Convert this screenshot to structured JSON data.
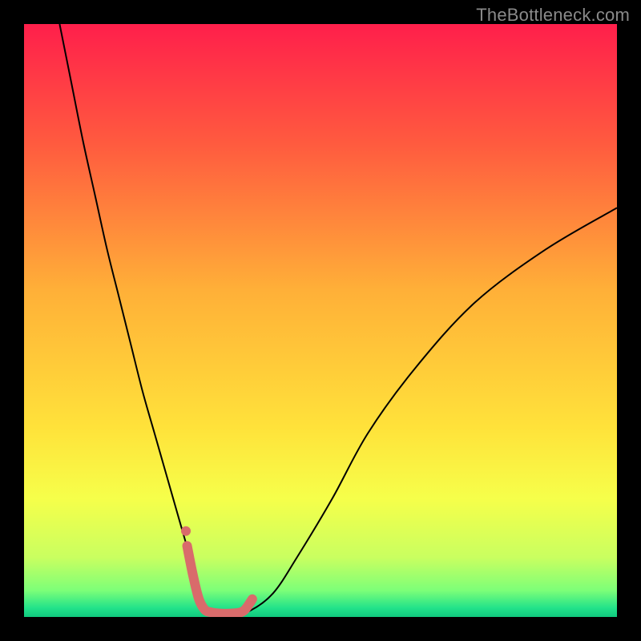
{
  "watermark": "TheBottleneck.com",
  "chart_data": {
    "type": "line",
    "title": "",
    "xlabel": "",
    "ylabel": "",
    "xlim": [
      0,
      100
    ],
    "ylim": [
      0,
      100
    ],
    "background_gradient": {
      "direction": "vertical",
      "stops": [
        {
          "pos": 0.0,
          "color": "#ff1f4b"
        },
        {
          "pos": 0.2,
          "color": "#ff5a3f"
        },
        {
          "pos": 0.45,
          "color": "#ffb038"
        },
        {
          "pos": 0.68,
          "color": "#ffe23a"
        },
        {
          "pos": 0.8,
          "color": "#f6ff4a"
        },
        {
          "pos": 0.9,
          "color": "#c9ff60"
        },
        {
          "pos": 0.955,
          "color": "#7dff78"
        },
        {
          "pos": 0.985,
          "color": "#22e28a"
        },
        {
          "pos": 1.0,
          "color": "#10c97e"
        }
      ]
    },
    "series": [
      {
        "name": "bottleneck-curve",
        "color": "#000000",
        "width": 2,
        "x": [
          6,
          8,
          10,
          12,
          14,
          16,
          18,
          20,
          22,
          24,
          26,
          28,
          29,
          30,
          31,
          33,
          35,
          38,
          42,
          46,
          52,
          58,
          66,
          76,
          88,
          100
        ],
        "y": [
          100,
          90,
          80,
          71,
          62,
          54,
          46,
          38,
          31,
          24,
          17,
          10,
          6,
          3,
          1.2,
          0.5,
          0.5,
          1,
          4,
          10,
          20,
          31,
          42,
          53,
          62,
          69
        ]
      },
      {
        "name": "highlight-band",
        "color": "#d96b6b",
        "width": 12,
        "linecap": "round",
        "x": [
          27.5,
          28.5,
          29.5,
          30.5,
          31.5,
          33,
          35,
          37,
          38.5
        ],
        "y": [
          12,
          7,
          3,
          1.2,
          0.8,
          0.6,
          0.6,
          1.0,
          3.0
        ]
      }
    ],
    "markers": [
      {
        "name": "highlight-dot",
        "x": 27.3,
        "y": 14.5,
        "r": 6,
        "color": "#d96b6b"
      }
    ]
  }
}
